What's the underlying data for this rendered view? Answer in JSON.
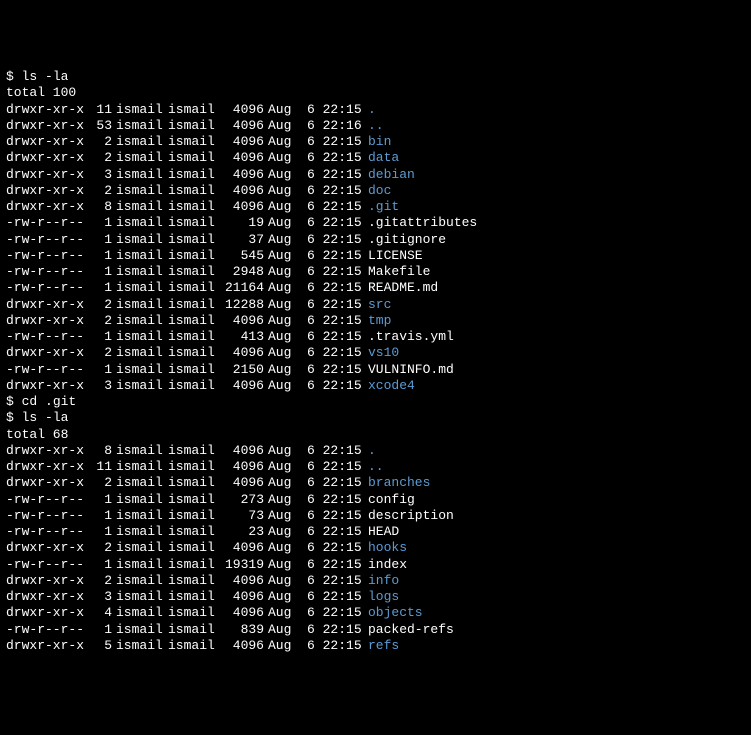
{
  "colors": {
    "background": "#000000",
    "text": "#ffffff",
    "directory": "#5c9bd4"
  },
  "blocks": [
    {
      "prompt": "$",
      "command": "ls -la",
      "total": "total 100",
      "entries": [
        {
          "perms": "drwxr-xr-x",
          "links": "11",
          "owner": "ismail",
          "group": "ismail",
          "size": "4096",
          "date": "Aug  6 22:15",
          "name": ".",
          "type": "dir"
        },
        {
          "perms": "drwxr-xr-x",
          "links": "53",
          "owner": "ismail",
          "group": "ismail",
          "size": "4096",
          "date": "Aug  6 22:16",
          "name": "..",
          "type": "dir"
        },
        {
          "perms": "drwxr-xr-x",
          "links": "2",
          "owner": "ismail",
          "group": "ismail",
          "size": "4096",
          "date": "Aug  6 22:15",
          "name": "bin",
          "type": "dir"
        },
        {
          "perms": "drwxr-xr-x",
          "links": "2",
          "owner": "ismail",
          "group": "ismail",
          "size": "4096",
          "date": "Aug  6 22:15",
          "name": "data",
          "type": "dir"
        },
        {
          "perms": "drwxr-xr-x",
          "links": "3",
          "owner": "ismail",
          "group": "ismail",
          "size": "4096",
          "date": "Aug  6 22:15",
          "name": "debian",
          "type": "dir"
        },
        {
          "perms": "drwxr-xr-x",
          "links": "2",
          "owner": "ismail",
          "group": "ismail",
          "size": "4096",
          "date": "Aug  6 22:15",
          "name": "doc",
          "type": "dir"
        },
        {
          "perms": "drwxr-xr-x",
          "links": "8",
          "owner": "ismail",
          "group": "ismail",
          "size": "4096",
          "date": "Aug  6 22:15",
          "name": ".git",
          "type": "dir"
        },
        {
          "perms": "-rw-r--r--",
          "links": "1",
          "owner": "ismail",
          "group": "ismail",
          "size": "19",
          "date": "Aug  6 22:15",
          "name": ".gitattributes",
          "type": "file"
        },
        {
          "perms": "-rw-r--r--",
          "links": "1",
          "owner": "ismail",
          "group": "ismail",
          "size": "37",
          "date": "Aug  6 22:15",
          "name": ".gitignore",
          "type": "file"
        },
        {
          "perms": "-rw-r--r--",
          "links": "1",
          "owner": "ismail",
          "group": "ismail",
          "size": "545",
          "date": "Aug  6 22:15",
          "name": "LICENSE",
          "type": "file"
        },
        {
          "perms": "-rw-r--r--",
          "links": "1",
          "owner": "ismail",
          "group": "ismail",
          "size": "2948",
          "date": "Aug  6 22:15",
          "name": "Makefile",
          "type": "file"
        },
        {
          "perms": "-rw-r--r--",
          "links": "1",
          "owner": "ismail",
          "group": "ismail",
          "size": "21164",
          "date": "Aug  6 22:15",
          "name": "README.md",
          "type": "file"
        },
        {
          "perms": "drwxr-xr-x",
          "links": "2",
          "owner": "ismail",
          "group": "ismail",
          "size": "12288",
          "date": "Aug  6 22:15",
          "name": "src",
          "type": "dir"
        },
        {
          "perms": "drwxr-xr-x",
          "links": "2",
          "owner": "ismail",
          "group": "ismail",
          "size": "4096",
          "date": "Aug  6 22:15",
          "name": "tmp",
          "type": "dir"
        },
        {
          "perms": "-rw-r--r--",
          "links": "1",
          "owner": "ismail",
          "group": "ismail",
          "size": "413",
          "date": "Aug  6 22:15",
          "name": ".travis.yml",
          "type": "file"
        },
        {
          "perms": "drwxr-xr-x",
          "links": "2",
          "owner": "ismail",
          "group": "ismail",
          "size": "4096",
          "date": "Aug  6 22:15",
          "name": "vs10",
          "type": "dir"
        },
        {
          "perms": "-rw-r--r--",
          "links": "1",
          "owner": "ismail",
          "group": "ismail",
          "size": "2150",
          "date": "Aug  6 22:15",
          "name": "VULNINFO.md",
          "type": "file"
        },
        {
          "perms": "drwxr-xr-x",
          "links": "3",
          "owner": "ismail",
          "group": "ismail",
          "size": "4096",
          "date": "Aug  6 22:15",
          "name": "xcode4",
          "type": "dir"
        }
      ]
    },
    {
      "prompt": "$",
      "command": "cd .git",
      "total": null,
      "entries": []
    },
    {
      "prompt": "$",
      "command": "ls -la",
      "total": "total 68",
      "entries": [
        {
          "perms": "drwxr-xr-x",
          "links": "8",
          "owner": "ismail",
          "group": "ismail",
          "size": "4096",
          "date": "Aug  6 22:15",
          "name": ".",
          "type": "dir"
        },
        {
          "perms": "drwxr-xr-x",
          "links": "11",
          "owner": "ismail",
          "group": "ismail",
          "size": "4096",
          "date": "Aug  6 22:15",
          "name": "..",
          "type": "dir"
        },
        {
          "perms": "drwxr-xr-x",
          "links": "2",
          "owner": "ismail",
          "group": "ismail",
          "size": "4096",
          "date": "Aug  6 22:15",
          "name": "branches",
          "type": "dir"
        },
        {
          "perms": "-rw-r--r--",
          "links": "1",
          "owner": "ismail",
          "group": "ismail",
          "size": "273",
          "date": "Aug  6 22:15",
          "name": "config",
          "type": "file"
        },
        {
          "perms": "-rw-r--r--",
          "links": "1",
          "owner": "ismail",
          "group": "ismail",
          "size": "73",
          "date": "Aug  6 22:15",
          "name": "description",
          "type": "file"
        },
        {
          "perms": "-rw-r--r--",
          "links": "1",
          "owner": "ismail",
          "group": "ismail",
          "size": "23",
          "date": "Aug  6 22:15",
          "name": "HEAD",
          "type": "file"
        },
        {
          "perms": "drwxr-xr-x",
          "links": "2",
          "owner": "ismail",
          "group": "ismail",
          "size": "4096",
          "date": "Aug  6 22:15",
          "name": "hooks",
          "type": "dir"
        },
        {
          "perms": "-rw-r--r--",
          "links": "1",
          "owner": "ismail",
          "group": "ismail",
          "size": "19319",
          "date": "Aug  6 22:15",
          "name": "index",
          "type": "file"
        },
        {
          "perms": "drwxr-xr-x",
          "links": "2",
          "owner": "ismail",
          "group": "ismail",
          "size": "4096",
          "date": "Aug  6 22:15",
          "name": "info",
          "type": "dir"
        },
        {
          "perms": "drwxr-xr-x",
          "links": "3",
          "owner": "ismail",
          "group": "ismail",
          "size": "4096",
          "date": "Aug  6 22:15",
          "name": "logs",
          "type": "dir"
        },
        {
          "perms": "drwxr-xr-x",
          "links": "4",
          "owner": "ismail",
          "group": "ismail",
          "size": "4096",
          "date": "Aug  6 22:15",
          "name": "objects",
          "type": "dir"
        },
        {
          "perms": "-rw-r--r--",
          "links": "1",
          "owner": "ismail",
          "group": "ismail",
          "size": "839",
          "date": "Aug  6 22:15",
          "name": "packed-refs",
          "type": "file"
        },
        {
          "perms": "drwxr-xr-x",
          "links": "5",
          "owner": "ismail",
          "group": "ismail",
          "size": "4096",
          "date": "Aug  6 22:15",
          "name": "refs",
          "type": "dir"
        }
      ]
    }
  ]
}
